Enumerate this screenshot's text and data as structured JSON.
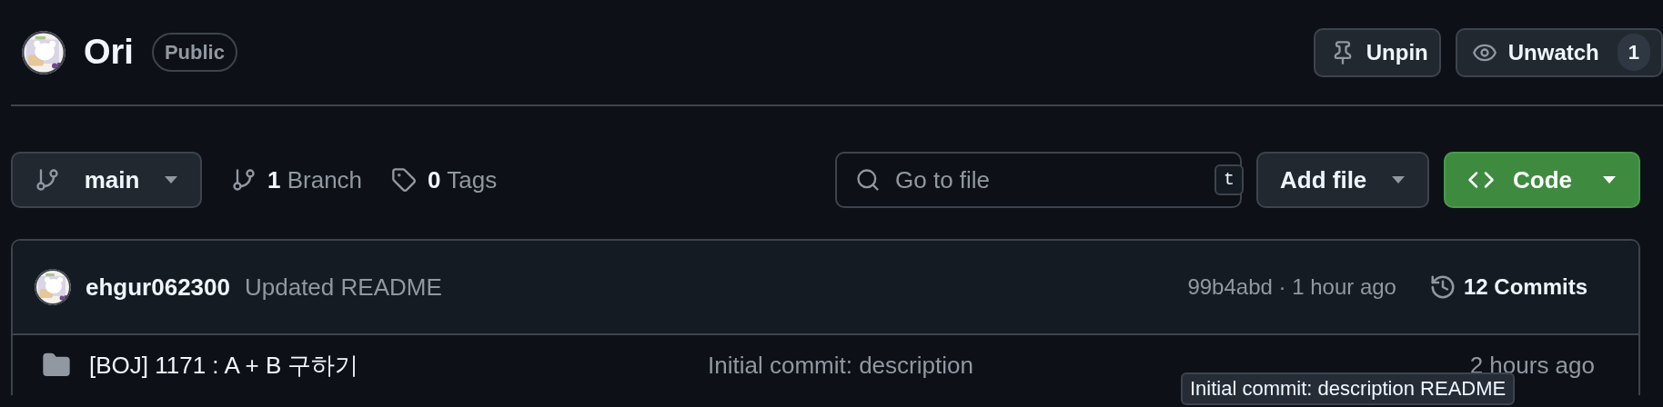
{
  "repo": {
    "name": "Ori",
    "visibility": "Public"
  },
  "actions": [
    {
      "kind": "pin",
      "label": "Unpin"
    },
    {
      "kind": "watch",
      "label": "Unwatch",
      "count": "1"
    }
  ],
  "branch": {
    "name": "main"
  },
  "branch_count": {
    "number": "1",
    "label": "Branch"
  },
  "tag_count": {
    "number": "0",
    "label": "Tags"
  },
  "search": {
    "placeholder": "Go to file",
    "shortcut": "t"
  },
  "add_file": {
    "label": "Add file"
  },
  "code": {
    "label": "Code"
  },
  "latest_commit": {
    "author": "ehgur062300",
    "message": "Updated README",
    "hash_time": "99b4abd · 1 hour ago",
    "commits": "12 Commits"
  },
  "files": [
    {
      "kind": "folder",
      "name": "[BOJ] 1171 : A + B 구하기",
      "message": "Initial commit: description",
      "time": "2 hours ago"
    }
  ],
  "tooltip": "Initial commit: description README"
}
